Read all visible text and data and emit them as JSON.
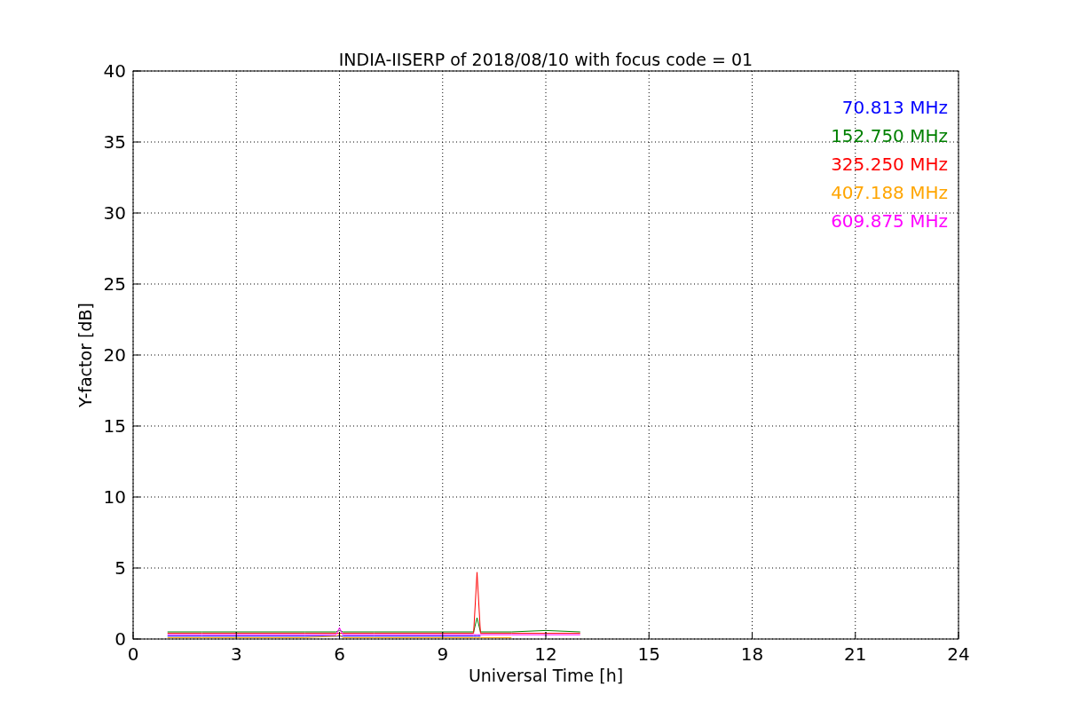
{
  "chart": {
    "chart_data": {
      "type": "line",
      "title": "INDIA-IISERP of 2018/08/10 with focus code = 01",
      "xlabel": "Universal Time [h]",
      "ylabel": "Y-factor [dB]",
      "grid": true,
      "x": [
        1,
        2,
        3,
        4,
        5,
        5.9,
        6,
        6.1,
        7,
        8,
        9,
        9.9,
        10,
        10.1,
        11,
        12,
        13
      ],
      "series": [
        {
          "name": "70.813 MHz",
          "color": "#0000ff",
          "values": [
            0.2,
            0.2,
            0.2,
            0.2,
            0.2,
            0.2,
            0.2,
            0.2,
            0.2,
            0.2,
            0.2,
            0.2,
            0.2,
            0.2,
            null,
            null,
            null
          ]
        },
        {
          "name": "152.750 MHz",
          "color": "#008000",
          "values": [
            0.5,
            0.5,
            0.5,
            0.5,
            0.5,
            0.5,
            0.6,
            0.5,
            0.5,
            0.5,
            0.5,
            0.5,
            1.5,
            0.5,
            0.5,
            0.6,
            0.5
          ]
        },
        {
          "name": "325.250 MHz",
          "color": "#ff0000",
          "values": [
            0.4,
            0.4,
            0.4,
            0.4,
            0.4,
            0.4,
            0.4,
            0.4,
            0.4,
            0.4,
            0.4,
            0.4,
            4.7,
            0.4,
            0.4,
            0.4,
            0.4
          ]
        },
        {
          "name": "407.188 MHz",
          "color": "#ffa500",
          "values": [
            0.1,
            0.1,
            0.1,
            0.1,
            0.1,
            0.2,
            0.3,
            0.1,
            0.1,
            0.1,
            0.1,
            0.1,
            0.1,
            0.1,
            0.1,
            null,
            null
          ]
        },
        {
          "name": "609.875 MHz",
          "color": "#ff00ff",
          "values": [
            0.3,
            0.3,
            0.3,
            0.3,
            0.3,
            0.3,
            0.8,
            0.3,
            0.3,
            0.3,
            0.3,
            0.3,
            0.3,
            0.3,
            0.3,
            0.3,
            0.3
          ]
        }
      ],
      "xlim": [
        0,
        24
      ],
      "ylim": [
        0,
        40
      ],
      "xticks": [
        0,
        3,
        6,
        9,
        12,
        15,
        18,
        21,
        24
      ],
      "yticks": [
        0,
        5,
        10,
        15,
        20,
        25,
        30,
        35,
        40
      ]
    }
  }
}
